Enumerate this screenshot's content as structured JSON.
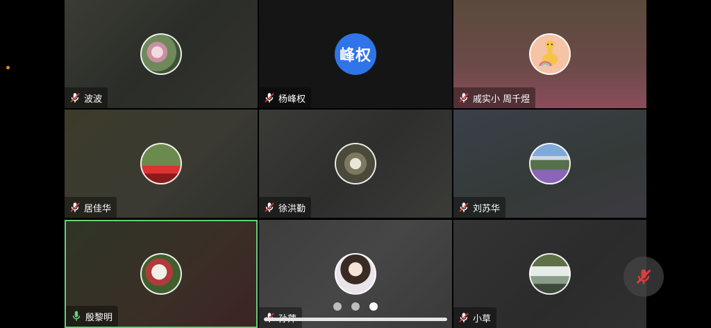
{
  "participants": [
    {
      "name": "波波",
      "muted": true,
      "avatar": "flower-photo"
    },
    {
      "name": "杨峰权",
      "muted": true,
      "avatar_text": "峰权",
      "avatar_color": "#2f74e8"
    },
    {
      "name": "戚实小 周千煜",
      "muted": true,
      "avatar": "giraffe-cartoon"
    },
    {
      "name": "居佳华",
      "muted": true,
      "avatar": "person-photo"
    },
    {
      "name": "徐洪勤",
      "muted": true,
      "avatar": "tunnel-photo"
    },
    {
      "name": "刘苏华",
      "muted": true,
      "avatar": "mountain-photo"
    },
    {
      "name": "殷黎明",
      "muted": false,
      "speaking": true,
      "avatar": "red-berries-photo"
    },
    {
      "name": "孙萍",
      "muted": true,
      "avatar": "doll-photo"
    },
    {
      "name": "小草",
      "muted": true,
      "avatar": "waterfall-photo"
    }
  ],
  "pagination": {
    "pages": 3,
    "current": 3
  },
  "controls": {
    "self_mic": "muted"
  },
  "colors": {
    "accent_speaking": "#66d17a",
    "mute_red": "#e03c3c",
    "initials_bg": "#2f74e8"
  }
}
